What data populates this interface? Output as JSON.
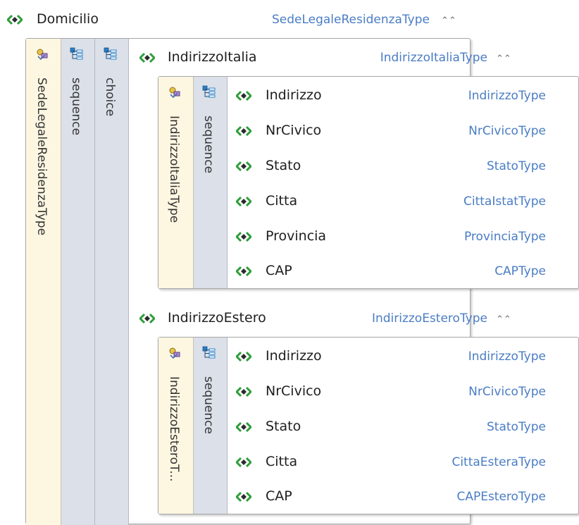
{
  "root": {
    "name": "Domicilio",
    "type": "SedeLegaleResidenzaType",
    "complex_label": "SedeLegaleResidenzaType",
    "sequence_label": "sequence",
    "choice_label": "choice",
    "collapse_glyph": "⌃⌃"
  },
  "italia": {
    "name": "IndirizzoItalia",
    "type": "IndirizzoItaliaType",
    "complex_label": "IndirizzoItaliaType",
    "sequence_label": "sequence",
    "collapse_glyph": "⌃⌃",
    "children": [
      {
        "name": "Indirizzo",
        "type": "IndirizzoType"
      },
      {
        "name": "NrCivico",
        "type": "NrCivicoType"
      },
      {
        "name": "Stato",
        "type": "StatoType"
      },
      {
        "name": "Citta",
        "type": "CittaIstatType"
      },
      {
        "name": "Provincia",
        "type": "ProvinciaType"
      },
      {
        "name": "CAP",
        "type": "CAPType"
      }
    ]
  },
  "estero": {
    "name": "IndirizzoEstero",
    "type": "IndirizzoEsteroType",
    "complex_label": "IndirizzoEsteroT...",
    "sequence_label": "sequence",
    "collapse_glyph": "⌃⌃",
    "children": [
      {
        "name": "Indirizzo",
        "type": "IndirizzoType"
      },
      {
        "name": "NrCivico",
        "type": "NrCivicoType"
      },
      {
        "name": "Stato",
        "type": "StatoType"
      },
      {
        "name": "Citta",
        "type": "CittaEsteraType"
      },
      {
        "name": "CAP",
        "type": "CAPEsteroType"
      }
    ]
  },
  "icons": {
    "element": "element-icon",
    "complex_type": "complex-type-icon",
    "sequence": "sequence-icon",
    "choice": "choice-icon"
  },
  "colors": {
    "type_text": "#4a7dc4",
    "element_icon": "#2e9e3a",
    "complex_column": "#fdf6e1",
    "sequence_column": "#dbe0e9"
  }
}
